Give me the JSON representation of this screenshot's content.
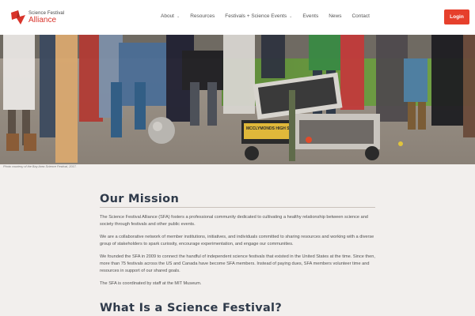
{
  "header": {
    "logo": {
      "line1": "Science Festival",
      "line2": "Alliance",
      "icon": "sfa-logo-icon",
      "brand_color": "#d9342b"
    },
    "nav": [
      {
        "label": "About",
        "has_dropdown": true
      },
      {
        "label": "Resources",
        "has_dropdown": false
      },
      {
        "label": "Festivals + Science Events",
        "has_dropdown": true
      },
      {
        "label": "Events",
        "has_dropdown": false
      },
      {
        "label": "News",
        "has_dropdown": false
      },
      {
        "label": "Contact",
        "has_dropdown": false
      }
    ],
    "login_label": "Login",
    "login_color": "#e6402c"
  },
  "hero": {
    "caption": "Photo courtesy of the Bay Area Science Festival, 2017.",
    "robot_sign": "MCCLYMONDS HIGH SCHOOL ROBOTICS TEAM"
  },
  "mission": {
    "title": "Our Mission",
    "paragraphs": [
      "The Science Festival Alliance (SFA) fosters a professional community dedicated to cultivating a healthy relationship between science and society through festivals and other public events.",
      "We are a collaborative network of member institutions, initiatives, and individuals committed to sharing resources and working with a diverse group of stakeholders to spark curiosity, encourage experimentation, and engage our communities.",
      "We founded the SFA in 2009 to connect the handful of independent science festivals that existed in the United States at the time. Since then, more than 75 festivals across the US and Canada have become SFA members. Instead of paying dues, SFA members volunteer time and resources in support of our shared goals.",
      "The SFA is coordinated by staff at the MIT Museum."
    ]
  },
  "next_section": {
    "title": "What Is a Science Festival?"
  }
}
